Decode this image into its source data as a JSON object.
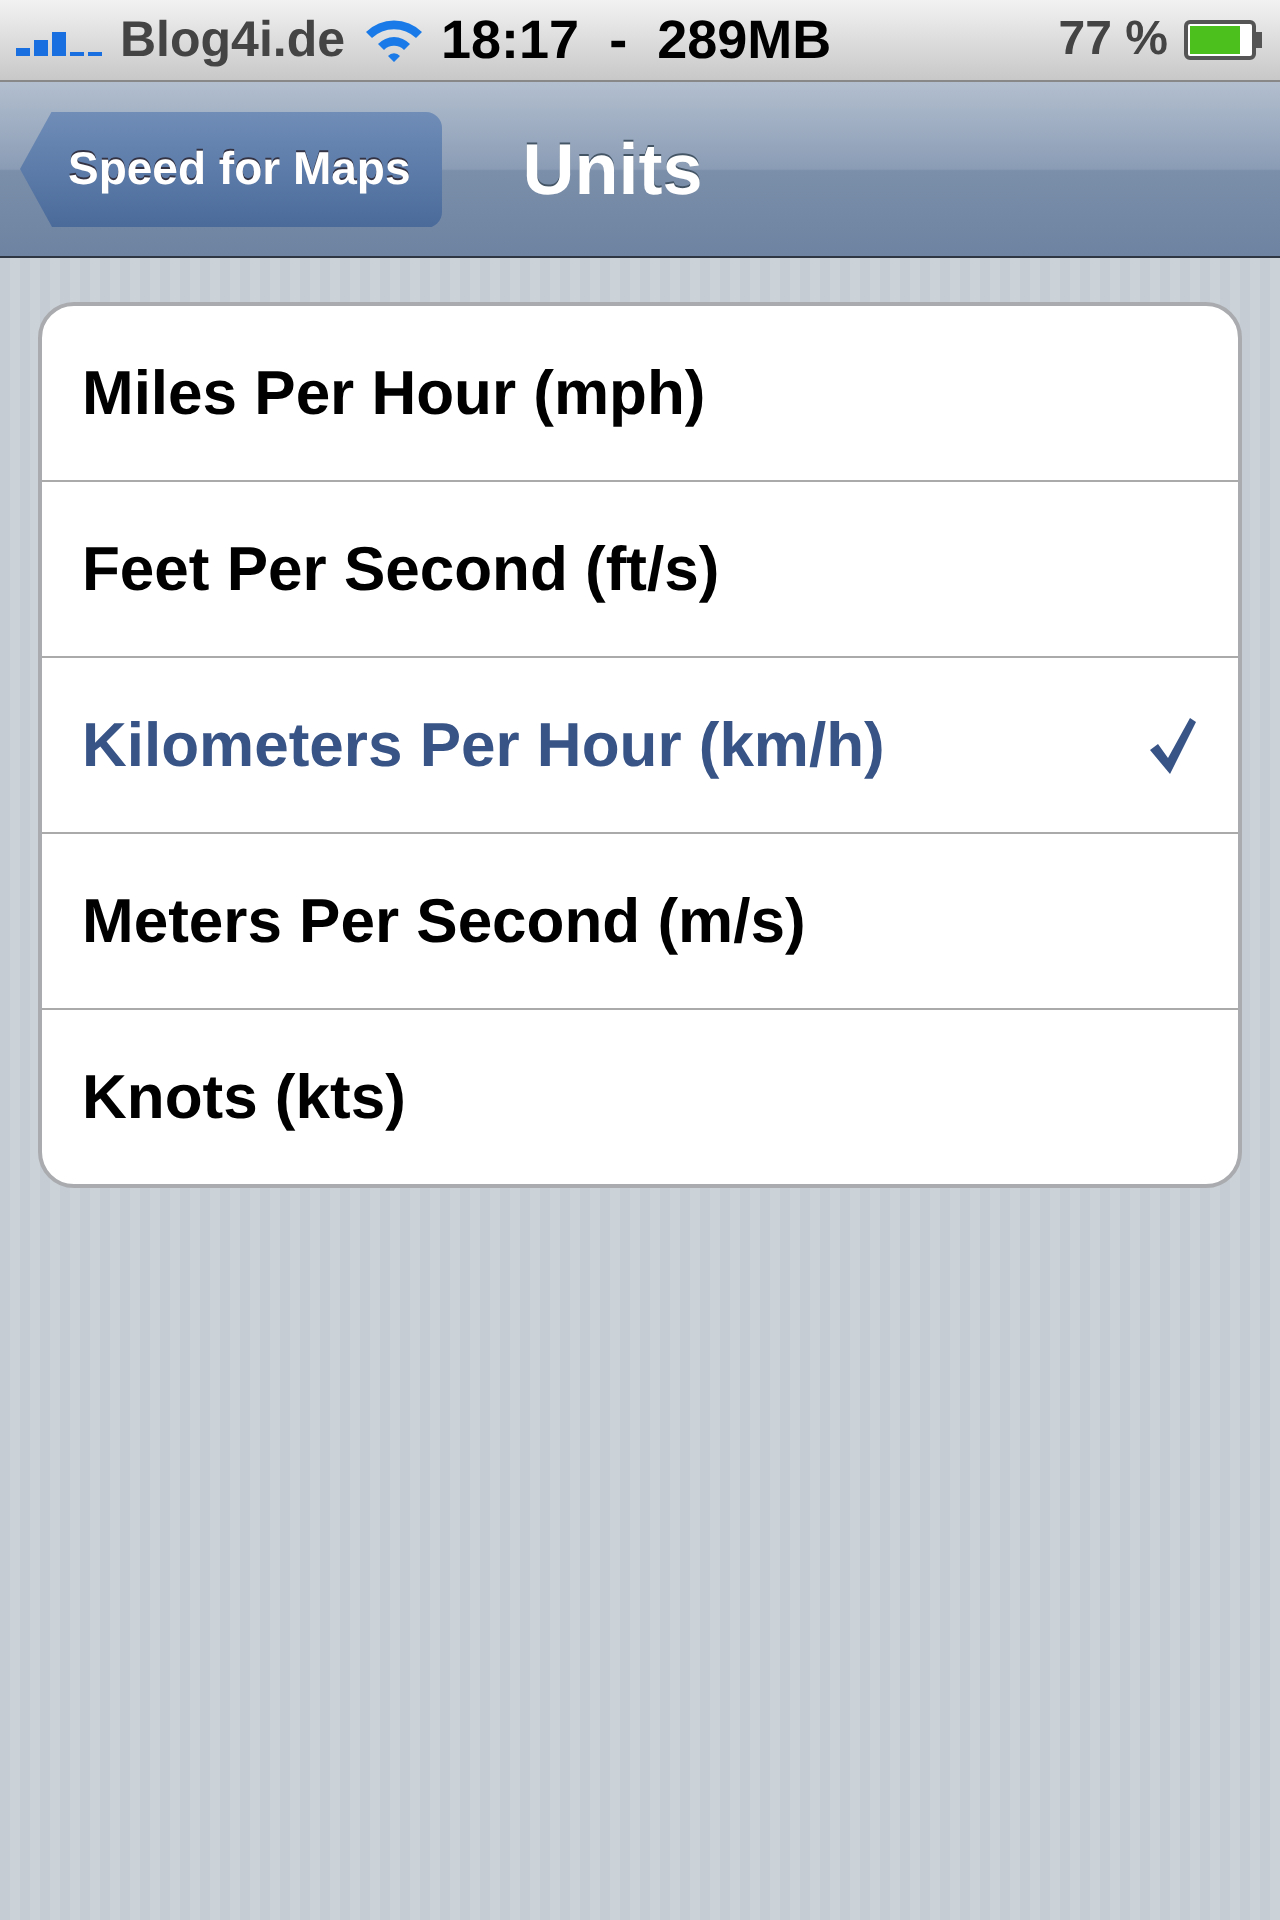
{
  "status_bar": {
    "carrier": "Blog4i.de",
    "time": "18:17  -  289MB",
    "battery": "77 %"
  },
  "nav": {
    "back": "Speed for Maps",
    "title": "Units"
  },
  "units": [
    {
      "label": "Miles Per Hour (mph)",
      "selected": false
    },
    {
      "label": "Feet Per Second (ft/s)",
      "selected": false
    },
    {
      "label": "Kilometers Per Hour (km/h)",
      "selected": true
    },
    {
      "label": "Meters Per Second (m/s)",
      "selected": false
    },
    {
      "label": "Knots (kts)",
      "selected": false
    }
  ]
}
